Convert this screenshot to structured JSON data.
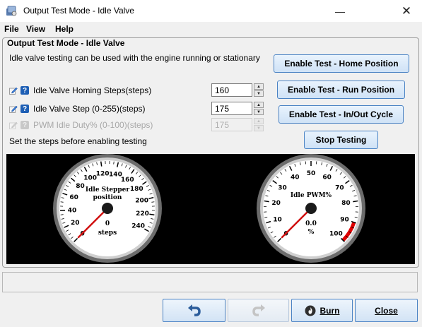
{
  "window": {
    "title": "Output Test Mode - Idle Valve",
    "minimize": "—",
    "close": "✕"
  },
  "menu": [
    {
      "label": "File"
    },
    {
      "label": "View"
    },
    {
      "label": "Help"
    }
  ],
  "panel": {
    "title": "Output Test Mode - Idle Valve",
    "description": "Idle valve testing can be used with the engine running or stationary",
    "rows": [
      {
        "label": "Idle Valve Homing Steps(steps)",
        "value": "160",
        "enabled": true
      },
      {
        "label": "Idle Valve Step (0-255)(steps)",
        "value": "175",
        "enabled": true
      },
      {
        "label": "PWM Idle Duty% (0-100)(steps)",
        "value": "175",
        "enabled": false
      }
    ],
    "hint": "Set the steps before enabling testing",
    "buttons": {
      "home": "Enable Test - Home Position",
      "run": "Enable Test - Run Position",
      "cycle": "Enable Test - In/Out Cycle",
      "stop": "Stop Testing"
    }
  },
  "gauges": [
    {
      "title_line1": "Idle Stepper",
      "title_line2": "position",
      "value": "0",
      "units": "steps",
      "ticks": [
        "0",
        "20",
        "40",
        "60",
        "80",
        "100",
        "120",
        "140",
        "160",
        "180",
        "200",
        "220",
        "240"
      ],
      "needle_value": 0,
      "min": 0,
      "max": 255
    },
    {
      "title_line1": "Idle PWM%",
      "title_line2": "",
      "value": "0.0",
      "units": "%",
      "ticks": [
        "0",
        "10",
        "20",
        "30",
        "40",
        "50",
        "60",
        "70",
        "80",
        "90",
        "100"
      ],
      "needle_value": 0,
      "min": 0,
      "max": 100,
      "redline_from": 90
    }
  ],
  "bottom": {
    "undo_icon": "undo-icon",
    "redo_icon": "redo-icon",
    "burn": "Burn",
    "close": "Close"
  },
  "colors": {
    "accent": "#4b83c4",
    "help": "#1e5fb5",
    "needle": "#d01010",
    "redline": "#e00000"
  }
}
